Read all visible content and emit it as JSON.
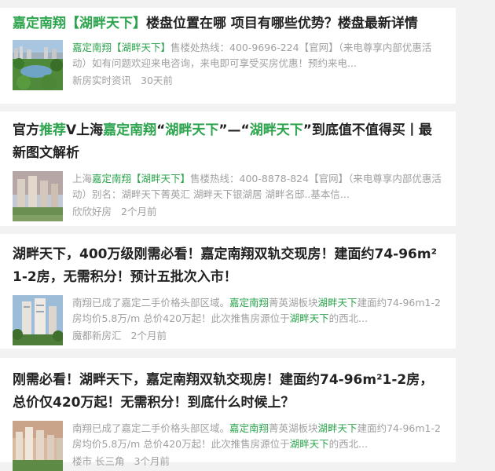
{
  "articles": [
    {
      "title": [
        {
          "t": "嘉定南翔【湖畔天下】",
          "hl": true
        },
        {
          "t": "楼盘位置在哪 项目有哪些优势？楼盘最新详情",
          "hl": false
        }
      ],
      "summary": [
        {
          "t": "嘉定南翔【湖畔天下】",
          "hl": true
        },
        {
          "t": "售楼处热线：400-9696-224【官网】（来电尊享内部优惠活动）如有问题欢迎来电咨询，来电即可享受买房优惠！预约来电...",
          "hl": false
        }
      ],
      "source": "新房实时资讯",
      "time": "30天前"
    },
    {
      "title": [
        {
          "t": "官方",
          "hl": false
        },
        {
          "t": "推荐",
          "hl": true
        },
        {
          "t": "V上海",
          "hl": false
        },
        {
          "t": "嘉定南翔",
          "hl": true
        },
        {
          "t": "“",
          "hl": false
        },
        {
          "t": "湖畔天下",
          "hl": true
        },
        {
          "t": "”—“",
          "hl": false
        },
        {
          "t": "湖畔天下",
          "hl": true
        },
        {
          "t": "”到底值不值得买丨最新图文解析",
          "hl": false
        }
      ],
      "summary": [
        {
          "t": "上海",
          "hl": false
        },
        {
          "t": "嘉定南翔【湖畔天下】",
          "hl": true
        },
        {
          "t": "售楼热线：400-8878-824【官网】（来电尊享内部优惠活动）别名：湖畔天下菁英汇 湖畔天下银湖居 湖畔名邸..基本信...",
          "hl": false
        }
      ],
      "source": "欣欣好房",
      "time": "2个月前"
    },
    {
      "title": [
        {
          "t": "湖畔天下，400万级刚需必看！嘉定南翔双轨交现房！建面约74-96m²1-2房，无需积分！预计五批次入市！",
          "hl": false
        }
      ],
      "summary": [
        {
          "t": "南翔已成了嘉定二手价格头部区域。",
          "hl": false
        },
        {
          "t": "嘉定南翔",
          "hl": true
        },
        {
          "t": "菁英湖板块",
          "hl": false
        },
        {
          "t": "湖畔天下",
          "hl": true
        },
        {
          "t": "建面约74-96m1-2房均价5.8万/m 总价420万起！此次推售房源位于",
          "hl": false
        },
        {
          "t": "湖畔天下",
          "hl": true
        },
        {
          "t": "的西北...",
          "hl": false
        }
      ],
      "source": "魔都新房汇",
      "time": "2个月前"
    },
    {
      "title": [
        {
          "t": "刚需必看！湖畔天下，嘉定南翔双轨交现房！建面约74-96m²1-2房，总价仅420万起！无需积分！到底什么时候上？",
          "hl": false
        }
      ],
      "summary": [
        {
          "t": "南翔已成了嘉定二手价格头部区域。",
          "hl": false
        },
        {
          "t": "嘉定南翔",
          "hl": true
        },
        {
          "t": "菁英湖板块",
          "hl": false
        },
        {
          "t": "湖畔天下",
          "hl": true
        },
        {
          "t": "建面约74-96m1-2房均价5.8万/m 总价420万起！此次推售房源位于",
          "hl": false
        },
        {
          "t": "湖畔天下",
          "hl": true
        },
        {
          "t": "的西北...",
          "hl": false
        }
      ],
      "source": "楼市 长三角",
      "time": "3个月前"
    }
  ],
  "colors": {
    "highlight": "#2da44e",
    "text": "#222222",
    "muted": "#a0a0a0",
    "background": "#f2f2f2"
  }
}
